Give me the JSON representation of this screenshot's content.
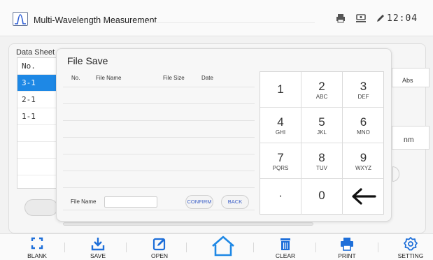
{
  "app": {
    "title": "Multi-Wavelength Measurement",
    "clock": "12:04"
  },
  "status_icons": [
    "printer-icon",
    "usb-icon",
    "pen-icon"
  ],
  "background": {
    "data_sheet_label": "Data Sheet",
    "table": {
      "header": "No.",
      "rows": [
        "3-1",
        "2-1",
        "1-1"
      ],
      "selected": "3-1"
    },
    "abs_label": "Abs",
    "nm_label": "nm"
  },
  "dialog": {
    "title": "File Save",
    "columns": [
      "No.",
      "File Name",
      "File Size",
      "Date"
    ],
    "file_name_label": "File Name",
    "file_name_value": "",
    "confirm_label": "CONFIRM",
    "back_label": "BACK"
  },
  "keypad": [
    {
      "n": "1",
      "l": ""
    },
    {
      "n": "2",
      "l": "ABC"
    },
    {
      "n": "3",
      "l": "DEF"
    },
    {
      "n": "4",
      "l": "GHI"
    },
    {
      "n": "5",
      "l": "JKL"
    },
    {
      "n": "6",
      "l": "MNO"
    },
    {
      "n": "7",
      "l": "PQRS"
    },
    {
      "n": "8",
      "l": "TUV"
    },
    {
      "n": "9",
      "l": "WXYZ"
    },
    {
      "n": "·",
      "l": ""
    },
    {
      "n": "0",
      "l": ""
    },
    {
      "n": "backspace-icon",
      "l": ""
    }
  ],
  "toolbar": {
    "blank": "BLANK",
    "save": "SAVE",
    "open": "OPEN",
    "home": "home-icon",
    "clear": "CLEAR",
    "print": "PRINT",
    "setting": "SETTING"
  },
  "colors": {
    "accent": "#1e88e5",
    "confirm_text": "#3b5fc8"
  }
}
